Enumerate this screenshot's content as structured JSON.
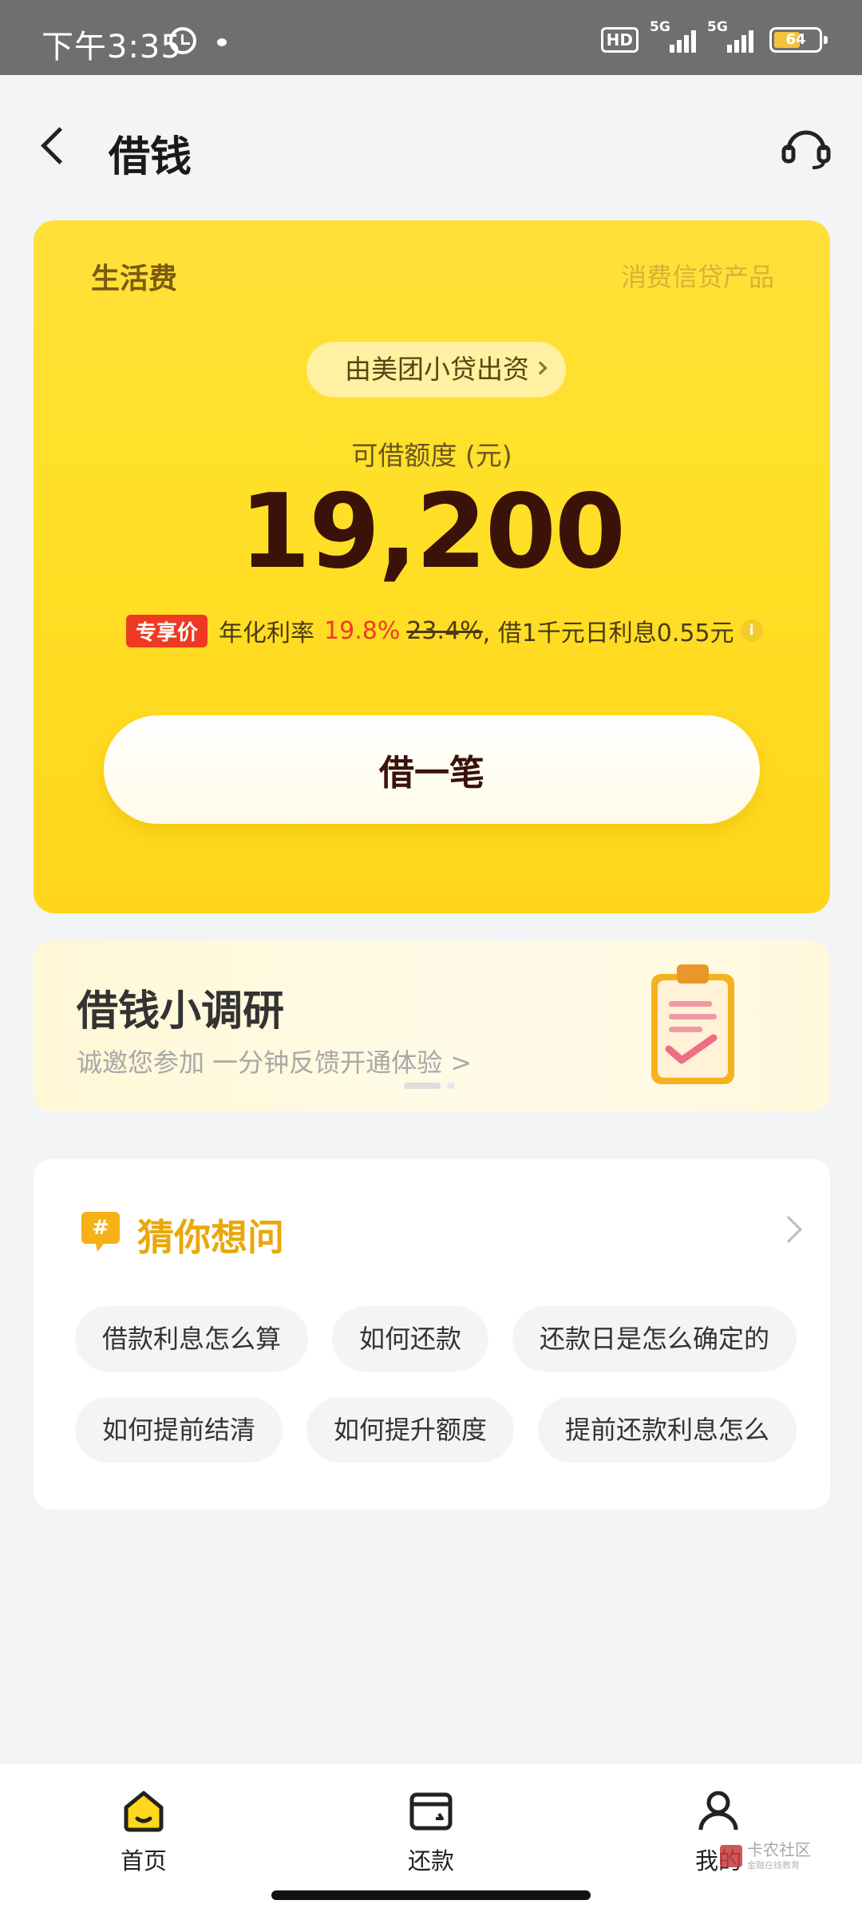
{
  "status_bar": {
    "time": "下午3:35",
    "hd_label": "HD",
    "network1": "5G",
    "network2": "5G",
    "battery": "64"
  },
  "header": {
    "title": "借钱"
  },
  "loan_card": {
    "product_name": "生活费",
    "product_tag": "消费信贷产品",
    "funder": "由美团小贷出资",
    "limit_label": "可借额度 (元)",
    "limit_value": "19,200",
    "rate_badge": "专享价",
    "rate_prefix": "年化利率",
    "rate_now": "19.8%",
    "rate_old": "23.4%",
    "rate_suffix": ", 借1千元日利息0.55元",
    "borrow_button": "借一笔"
  },
  "survey": {
    "title": "借钱小调研",
    "subtitle": "诚邀您参加   一分钟反馈开通体验 >"
  },
  "faq": {
    "title": "猜你想问",
    "row1": [
      "借款利息怎么算",
      "如何还款",
      "还款日是怎么确定的"
    ],
    "row2": [
      "如何提前结清",
      "如何提升额度",
      "提前还款利息怎么"
    ]
  },
  "bottom_nav": {
    "home": "首页",
    "repay": "还款",
    "mine": "我的"
  },
  "watermark": {
    "brand": "卡农社区",
    "sub": "金融在线教育"
  },
  "colors": {
    "card_yellow": "#ffe027",
    "accent_red": "#ee3a23",
    "faq_title": "#e9a80a"
  }
}
